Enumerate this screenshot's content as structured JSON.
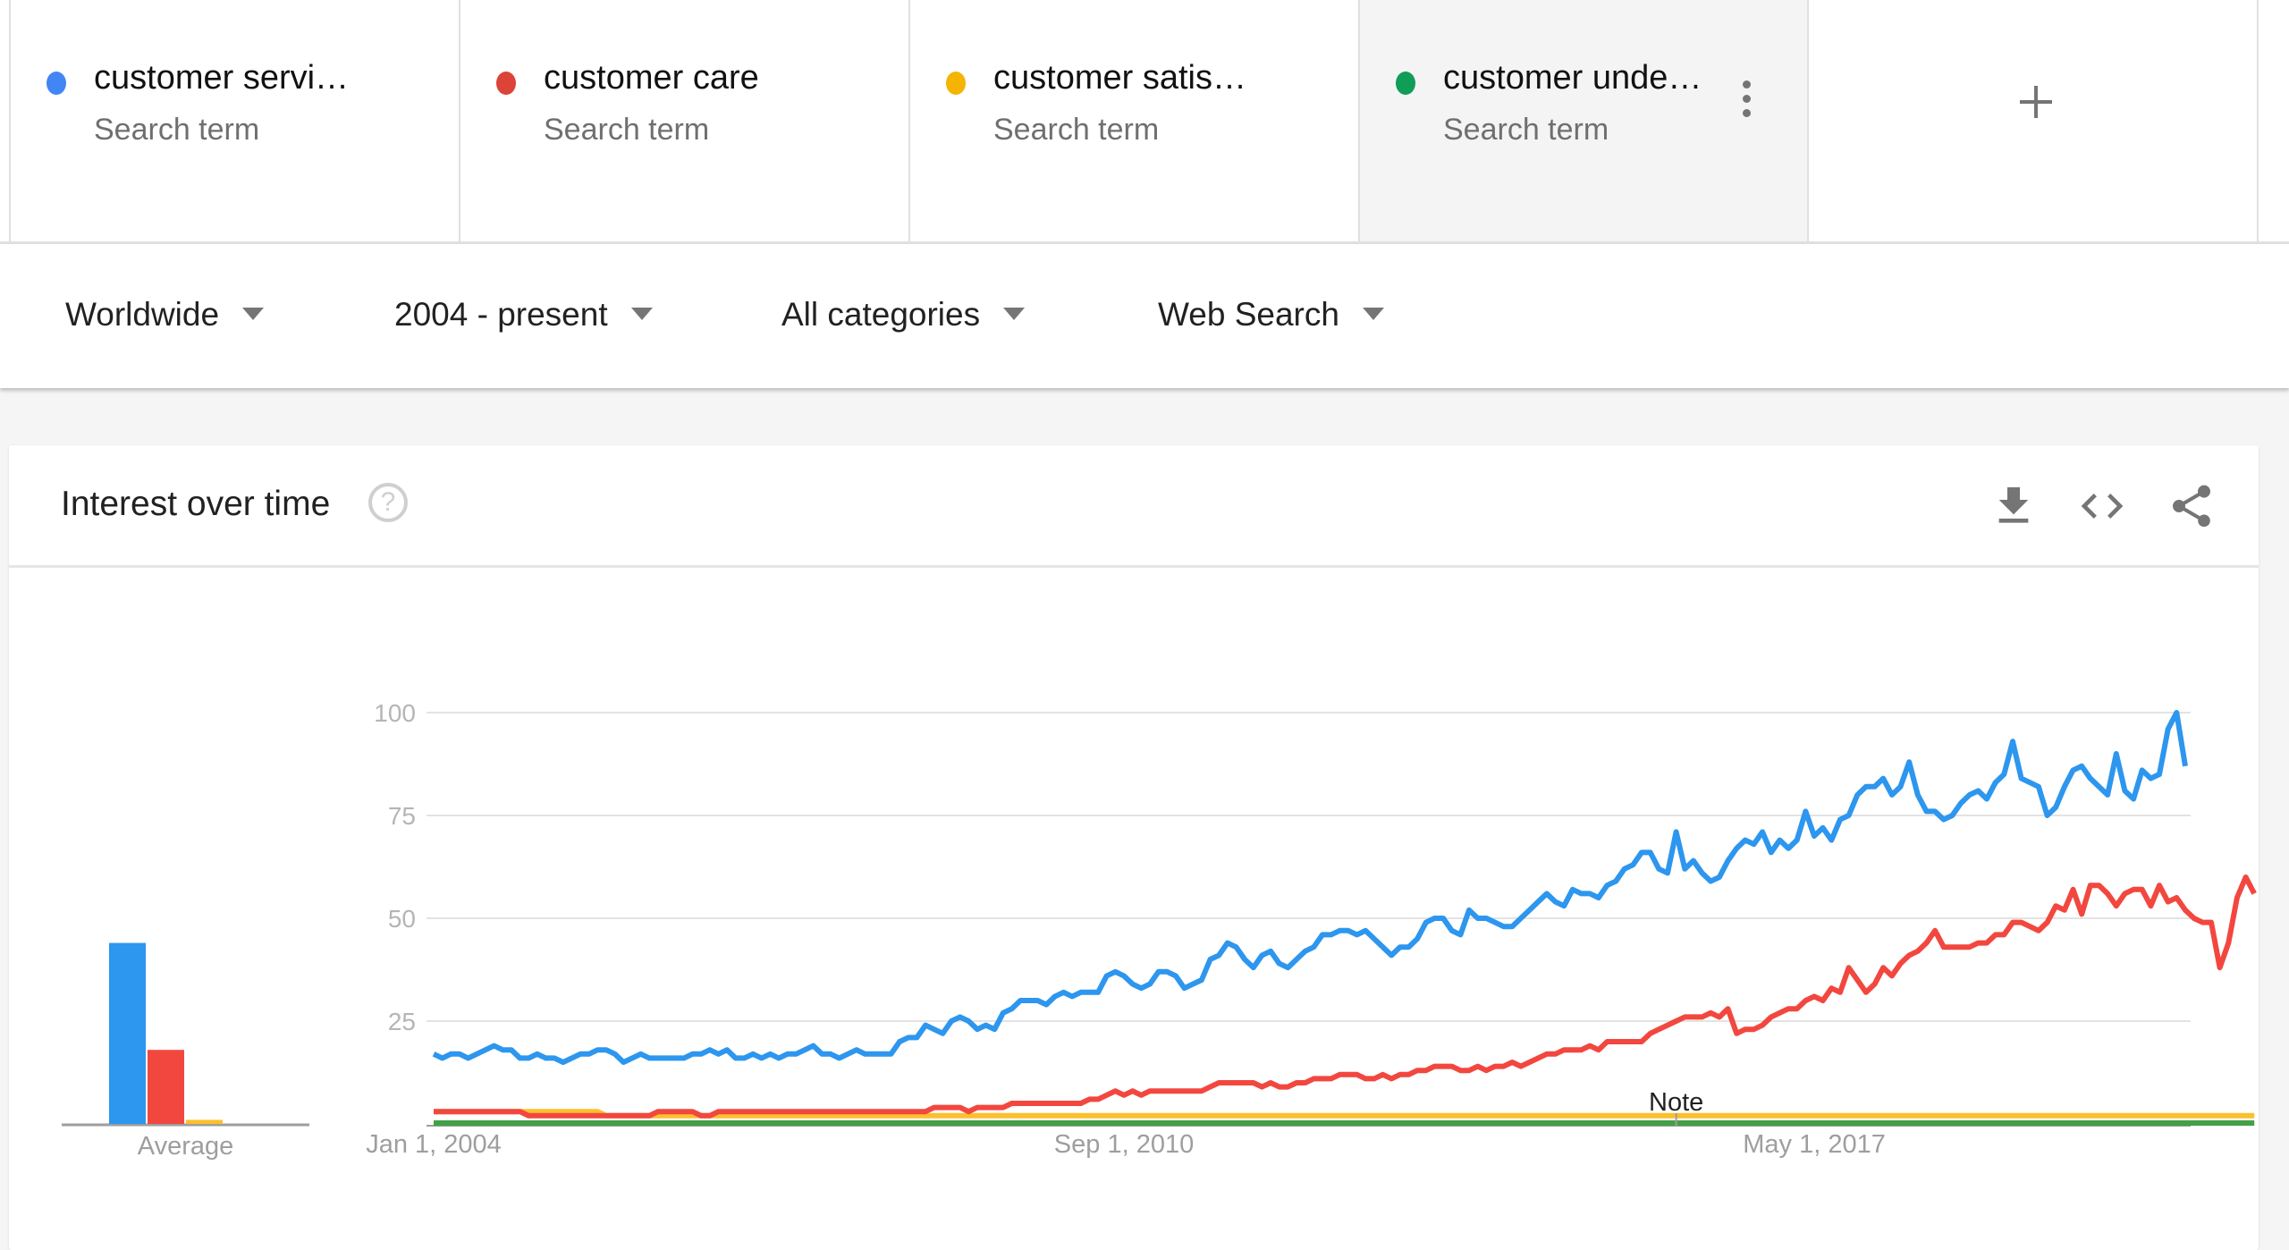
{
  "search_terms": [
    {
      "label": "customer servi…",
      "sublabel": "Search term",
      "color": "#4285f4"
    },
    {
      "label": "customer care",
      "sublabel": "Search term",
      "color": "#db4437"
    },
    {
      "label": "customer satis…",
      "sublabel": "Search term",
      "color": "#f4b400"
    },
    {
      "label": "customer unde…",
      "sublabel": "Search term",
      "color": "#0f9d58"
    }
  ],
  "add_term_icon": "plus-icon",
  "filters": [
    {
      "label": "Worldwide"
    },
    {
      "label": "2004 - present"
    },
    {
      "label": "All categories"
    },
    {
      "label": "Web Search"
    }
  ],
  "card": {
    "title": "Interest over time",
    "help_glyph": "?",
    "actions": [
      "download-icon",
      "embed-code-icon",
      "share-icon"
    ]
  },
  "chart_data": [
    {
      "type": "bar",
      "title": "",
      "categories": [
        "Average"
      ],
      "xlabel": "Average",
      "ylim": [
        0,
        100
      ],
      "series": [
        {
          "name": "customer service",
          "color": "#2d96ee",
          "values": [
            44
          ]
        },
        {
          "name": "customer care",
          "color": "#f2473f",
          "values": [
            18
          ]
        },
        {
          "name": "customer satisfaction",
          "color": "#fbc02d",
          "values": [
            1
          ]
        },
        {
          "name": "customer understanding",
          "color": "#43a047",
          "values": [
            0
          ]
        }
      ]
    },
    {
      "type": "line",
      "title": "Interest over time",
      "x_start": "2004-01",
      "x_interval": "month",
      "xlabel": "",
      "ylabel": "",
      "ylim": [
        0,
        100
      ],
      "yticks": [
        25,
        50,
        75,
        100
      ],
      "xtick_labels": [
        {
          "label": "Jan 1, 2004",
          "index": 0
        },
        {
          "label": "Sep 1, 2010",
          "index": 80
        },
        {
          "label": "May 1, 2017",
          "index": 160
        }
      ],
      "annotation": {
        "label": "Note",
        "index": 144
      },
      "grid": true,
      "series": [
        {
          "name": "customer service",
          "color": "#2d96ee",
          "values": [
            17,
            16,
            17,
            17,
            16,
            17,
            18,
            19,
            18,
            18,
            16,
            16,
            17,
            16,
            16,
            15,
            16,
            17,
            17,
            18,
            18,
            17,
            15,
            16,
            17,
            16,
            16,
            16,
            16,
            16,
            17,
            17,
            18,
            17,
            18,
            16,
            16,
            17,
            16,
            17,
            16,
            17,
            17,
            18,
            19,
            17,
            17,
            16,
            17,
            18,
            17,
            17,
            17,
            17,
            20,
            21,
            21,
            24,
            23,
            22,
            25,
            26,
            25,
            23,
            24,
            23,
            27,
            28,
            30,
            30,
            30,
            29,
            31,
            32,
            31,
            32,
            32,
            32,
            36,
            37,
            36,
            34,
            33,
            34,
            37,
            37,
            36,
            33,
            34,
            35,
            40,
            41,
            44,
            43,
            40,
            38,
            41,
            42,
            39,
            38,
            40,
            42,
            43,
            46,
            46,
            47,
            47,
            46,
            47,
            45,
            43,
            41,
            43,
            43,
            45,
            49,
            50,
            50,
            47,
            46,
            52,
            50,
            50,
            49,
            48,
            48,
            50,
            52,
            54,
            56,
            54,
            53,
            57,
            56,
            56,
            55,
            58,
            59,
            62,
            63,
            66,
            66,
            62,
            61,
            71,
            62,
            64,
            61,
            59,
            60,
            64,
            67,
            69,
            68,
            71,
            66,
            69,
            67,
            69,
            76,
            70,
            72,
            69,
            74,
            75,
            80,
            82,
            82,
            84,
            80,
            82,
            88,
            80,
            76,
            76,
            74,
            75,
            78,
            80,
            81,
            79,
            83,
            85,
            93,
            84,
            83,
            82,
            75,
            77,
            82,
            86,
            87,
            84,
            82,
            80,
            90,
            81,
            79,
            86,
            84,
            85,
            96,
            100,
            87
          ]
        },
        {
          "name": "customer care",
          "color": "#f2473f",
          "values": [
            3,
            3,
            3,
            3,
            3,
            3,
            3,
            3,
            3,
            3,
            3,
            2,
            2,
            2,
            2,
            2,
            2,
            2,
            2,
            2,
            2,
            2,
            2,
            2,
            2,
            2,
            3,
            3,
            3,
            3,
            3,
            2,
            2,
            3,
            3,
            3,
            3,
            3,
            3,
            3,
            3,
            3,
            3,
            3,
            3,
            3,
            3,
            3,
            3,
            3,
            3,
            3,
            3,
            3,
            3,
            3,
            3,
            3,
            4,
            4,
            4,
            4,
            3,
            4,
            4,
            4,
            4,
            5,
            5,
            5,
            5,
            5,
            5,
            5,
            5,
            5,
            6,
            6,
            7,
            8,
            7,
            8,
            7,
            8,
            8,
            8,
            8,
            8,
            8,
            8,
            9,
            10,
            10,
            10,
            10,
            10,
            9,
            10,
            9,
            9,
            10,
            10,
            11,
            11,
            11,
            12,
            12,
            12,
            11,
            11,
            12,
            11,
            12,
            12,
            13,
            13,
            14,
            14,
            14,
            13,
            13,
            14,
            13,
            14,
            14,
            15,
            14,
            15,
            16,
            17,
            17,
            18,
            18,
            18,
            19,
            18,
            20,
            20,
            20,
            20,
            20,
            22,
            23,
            24,
            25,
            26,
            26,
            26,
            27,
            26,
            28,
            22,
            23,
            23,
            24,
            26,
            27,
            28,
            28,
            30,
            31,
            30,
            33,
            32,
            38,
            35,
            32,
            34,
            38,
            36,
            39,
            41,
            42,
            44,
            47,
            43,
            43,
            43,
            43,
            44,
            44,
            46,
            46,
            49,
            49,
            48,
            47,
            49,
            53,
            52,
            57,
            51,
            58,
            58,
            56,
            53,
            56,
            57,
            57,
            53,
            58,
            54,
            55,
            52,
            50,
            49,
            49,
            38,
            44,
            55,
            60,
            56
          ]
        },
        {
          "name": "customer satisfaction",
          "color": "#fbc02d",
          "values": [
            3,
            3,
            3,
            3,
            3,
            3,
            3,
            3,
            3,
            3,
            3,
            3,
            3,
            3,
            3,
            3,
            3,
            3,
            3,
            3,
            2,
            2,
            2,
            2,
            2,
            2,
            2,
            2,
            2,
            2,
            2,
            2,
            2,
            2,
            2,
            2,
            2,
            2,
            2,
            2,
            2,
            2,
            2,
            2,
            2,
            2,
            2,
            2,
            2,
            2,
            2,
            2,
            2,
            2,
            2,
            2,
            2,
            2,
            2,
            2,
            2,
            2,
            2,
            2,
            2,
            2,
            2,
            2,
            2,
            2,
            2,
            2,
            2,
            2,
            2,
            2,
            2,
            2,
            2,
            2,
            2,
            2,
            2,
            2,
            2,
            2,
            2,
            2,
            2,
            2,
            2,
            2,
            2,
            2,
            2,
            2,
            2,
            2,
            2,
            2,
            2,
            2,
            2,
            2,
            2,
            2,
            2,
            2,
            2,
            2,
            2,
            2,
            2,
            2,
            2,
            2,
            2,
            2,
            2,
            2,
            2,
            2,
            2,
            2,
            2,
            2,
            2,
            2,
            2,
            2,
            2,
            2,
            2,
            2,
            2,
            2,
            2,
            2,
            2,
            2,
            2,
            2,
            2,
            2,
            2,
            2,
            2,
            2,
            2,
            2,
            2,
            2,
            2,
            2,
            2,
            2,
            2,
            2,
            2,
            2,
            2,
            2,
            2,
            2,
            2,
            2,
            2,
            2,
            2,
            2,
            2,
            2,
            2,
            2,
            2,
            2,
            2,
            2,
            2,
            2,
            2,
            2,
            2,
            2,
            2,
            2,
            2,
            2,
            2,
            2,
            2,
            2,
            2,
            2,
            2,
            2,
            2,
            2,
            2,
            2,
            2,
            2,
            2,
            2,
            2,
            2,
            2,
            2,
            2,
            2,
            2,
            2
          ]
        },
        {
          "name": "customer understanding",
          "color": "#43a047",
          "values": [
            0,
            0,
            0,
            0,
            0,
            0,
            0,
            0,
            0,
            0,
            0,
            0,
            0,
            0,
            0,
            0,
            0,
            0,
            0,
            0,
            0,
            0,
            0,
            0,
            0,
            0,
            0,
            0,
            0,
            0,
            0,
            0,
            0,
            0,
            0,
            0,
            0,
            0,
            0,
            0,
            0,
            0,
            0,
            0,
            0,
            0,
            0,
            0,
            0,
            0,
            0,
            0,
            0,
            0,
            0,
            0,
            0,
            0,
            0,
            0,
            0,
            0,
            0,
            0,
            0,
            0,
            0,
            0,
            0,
            0,
            0,
            0,
            0,
            0,
            0,
            0,
            0,
            0,
            0,
            0,
            0,
            0,
            0,
            0,
            0,
            0,
            0,
            0,
            0,
            0,
            0,
            0,
            0,
            0,
            0,
            0,
            0,
            0,
            0,
            0,
            0,
            0,
            0,
            0,
            0,
            0,
            0,
            0,
            0,
            0,
            0,
            0,
            0,
            0,
            0,
            0,
            0,
            0,
            0,
            0,
            0,
            0,
            0,
            0,
            0,
            0,
            0,
            0,
            0,
            0,
            0,
            0,
            0,
            0,
            0,
            0,
            0,
            0,
            0,
            0,
            0,
            0,
            0,
            0,
            0,
            0,
            0,
            0,
            0,
            0,
            0,
            0,
            0,
            0,
            0,
            0,
            0,
            0,
            0,
            0,
            0,
            0,
            0,
            0,
            0,
            0,
            0,
            0,
            0,
            0,
            0,
            0,
            0,
            0,
            0,
            0,
            0,
            0,
            0,
            0,
            0,
            0,
            0,
            0,
            0,
            0,
            0,
            0,
            0,
            0,
            0,
            0,
            0,
            0,
            0,
            0,
            0,
            0,
            0,
            0,
            0,
            0,
            0,
            0,
            0,
            0,
            0,
            0,
            0,
            0,
            0,
            0
          ]
        }
      ]
    }
  ]
}
